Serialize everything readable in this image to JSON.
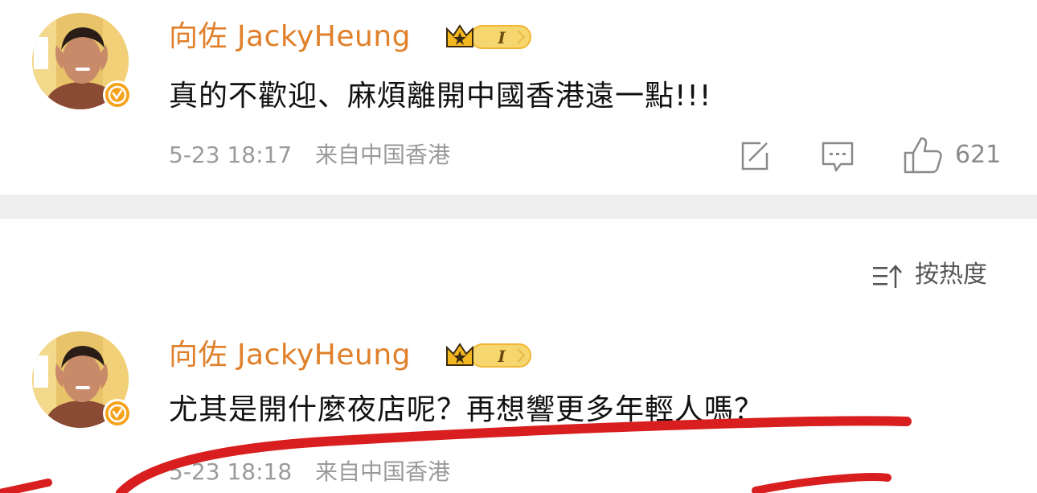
{
  "posts": [
    {
      "username": "向佐 JackyHeung",
      "badge_level": "I",
      "content": "真的不歡迎、麻煩離開中國香港遠一點!!!",
      "time": "5-23 18:17",
      "source": "来自中国香港",
      "likes": "621"
    },
    {
      "username": "向佐 JackyHeung",
      "badge_level": "I",
      "content": "尤其是開什麼夜店呢？再想響更多年輕人嗎？",
      "time": "5-23 18:18",
      "source": "来自中国香港"
    }
  ],
  "sort": {
    "label": "按热度"
  },
  "icons": {
    "share": "share-icon",
    "comment": "comment-icon",
    "like": "thumbs-up-icon",
    "sort": "sort-icon",
    "verified": "verified-badge-icon",
    "crown": "crown-icon"
  },
  "colors": {
    "username": "#e0802a",
    "verified": "#f7a21b",
    "meta": "#9a9a9a",
    "annotation": "#d81e1e",
    "badge": "#f2b632"
  }
}
